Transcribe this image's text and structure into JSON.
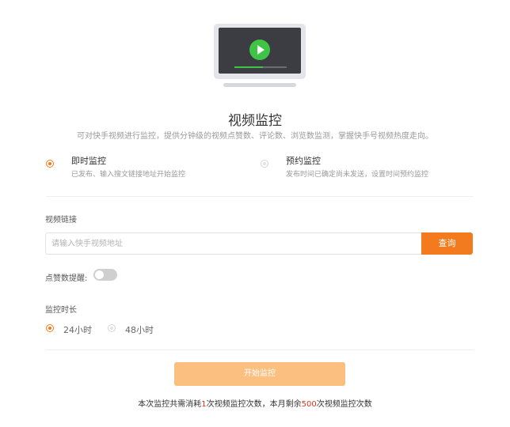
{
  "illustration": {
    "name": "monitor-play-icon",
    "play_progress_fraction": 0.55,
    "accent_color": "#3fc445"
  },
  "header": {
    "title": "视频监控",
    "subtitle": "可对快手视频进行监控，提供分钟级的视频点赞数、评论数、浏览数监测，掌握快手号视频热度走向。"
  },
  "modes": [
    {
      "title": "即时监控",
      "desc": "已发布、输入搜文链接地址开始监控",
      "selected": true
    },
    {
      "title": "预约监控",
      "desc": "发布时间已确定尚未发送，设置时间预约监控",
      "selected": false
    }
  ],
  "video_link": {
    "label": "视频链接",
    "placeholder": "请输入快手视频地址",
    "value": "",
    "button_label": "查询"
  },
  "like_alert": {
    "label": "点赞数提醒:",
    "enabled": false
  },
  "duration": {
    "label": "监控时长",
    "options": [
      {
        "label": "24小时",
        "selected": true
      },
      {
        "label": "48小时",
        "selected": false
      }
    ]
  },
  "start_button_label": "开始监控",
  "footer": {
    "part1": "本次监控共需消耗",
    "count1": "1",
    "part2": "次视频监控次数，本月剩余",
    "count2": "500",
    "part3": "次视频监控次数"
  },
  "colors": {
    "accent": "#f37b1d",
    "accent_light": "#fbbf7f",
    "highlight": "#e0321b"
  }
}
